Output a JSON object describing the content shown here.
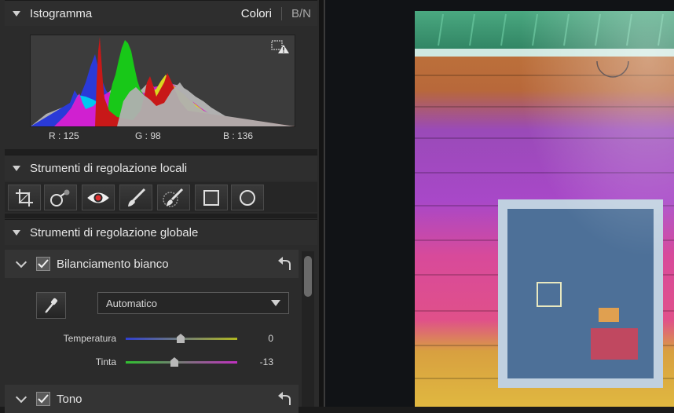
{
  "histogram": {
    "title": "Istogramma",
    "tab_color": "Colori",
    "tab_bw": "B/N",
    "readout_r": "R : 125",
    "readout_g": "G : 98",
    "readout_b": "B : 136"
  },
  "local_tools": {
    "title": "Strumenti di regolazione locali",
    "icons": [
      "crop-icon",
      "spot-removal-icon",
      "red-eye-icon",
      "brush-icon",
      "eraser-brush-icon",
      "rectangle-icon",
      "circle-icon"
    ]
  },
  "global_tools": {
    "title": "Strumenti di regolazione globale"
  },
  "white_balance": {
    "title": "Bilanciamento bianco",
    "checked": true,
    "mode_value": "Automatico",
    "temperature_label": "Temperatura",
    "temperature_value": "0",
    "tint_label": "Tinta",
    "tint_value": "-13"
  },
  "tone": {
    "title": "Tono",
    "checked": true
  },
  "colors": {
    "accent": "#e04a4a",
    "panel_bg": "#2b2b2b"
  }
}
